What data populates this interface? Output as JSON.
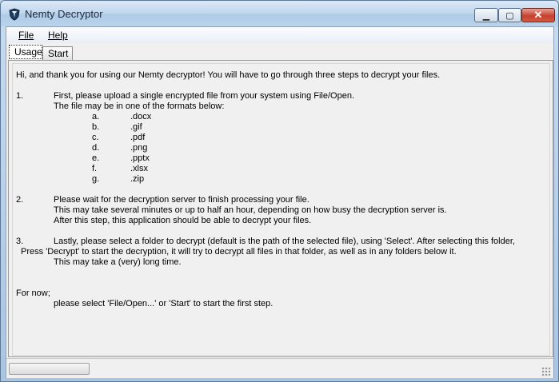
{
  "window": {
    "title": "Nemty Decryptor"
  },
  "menu": {
    "file": "File",
    "help": "Help"
  },
  "tabs": {
    "usage": "Usage",
    "start": "Start"
  },
  "content": {
    "intro": "Hi, and thank you for using our Nemty decryptor! You will have to go through three steps to decrypt your files.",
    "step1": {
      "num": "1.",
      "text1": "First, please upload a single encrypted file from your system using File/Open.",
      "text2": "The file may be in one of the formats below:",
      "formats": [
        {
          "letter": "a.",
          "ext": ".docx"
        },
        {
          "letter": "b.",
          "ext": ".gif"
        },
        {
          "letter": "c.",
          "ext": ".pdf"
        },
        {
          "letter": "d.",
          "ext": ".png"
        },
        {
          "letter": "e.",
          "ext": ".pptx"
        },
        {
          "letter": "f.",
          "ext": ".xlsx"
        },
        {
          "letter": "g.",
          "ext": ".zip"
        }
      ]
    },
    "step2": {
      "num": "2.",
      "text1": "Please wait for the decryption server to finish processing your file.",
      "text2": "This may take several minutes or up to half an hour, depending on how busy the decryption server is.",
      "text3": "After this step, this application should be able to decrypt your files."
    },
    "step3": {
      "num": "3.",
      "text1": "Lastly, please select a folder to decrypt (default is the path of the selected file), using 'Select'. After selecting this folder,",
      "text2": "Press 'Decrypt' to start the decryption, it will try to decrypt all files in that folder, as well as in any folders below it.",
      "text3": "This may take a (very) long time."
    },
    "fornow": "For now;",
    "fornow_text": "please select 'File/Open...' or 'Start' to start the first step."
  },
  "colors": {
    "close_button": "#c7402e",
    "titlebar": "#c3d8ee"
  }
}
